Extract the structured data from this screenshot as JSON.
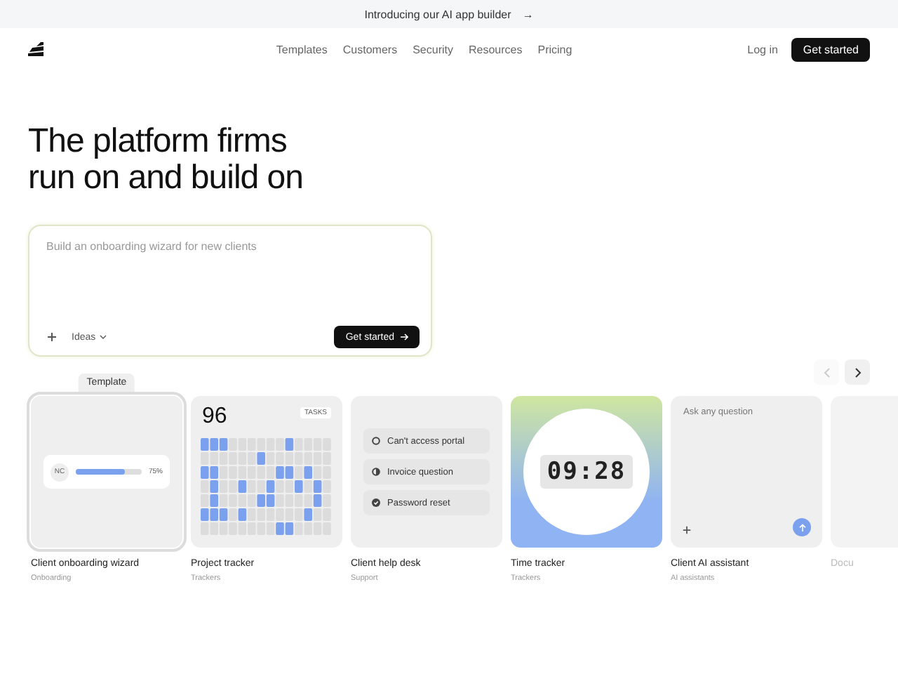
{
  "banner": {
    "text": "Introducing our AI app builder",
    "arrow": "→"
  },
  "nav": {
    "links": [
      "Templates",
      "Customers",
      "Security",
      "Resources",
      "Pricing"
    ],
    "login": "Log in",
    "cta": "Get started"
  },
  "hero": {
    "title_lines": [
      "The platform firms",
      "run on and build on"
    ]
  },
  "prompt": {
    "placeholder": "Build an onboarding wizard for new clients",
    "ideas": "Ideas",
    "submit": "Get started"
  },
  "carousel": {
    "prev_disabled": true,
    "next_disabled": false
  },
  "cards": [
    {
      "kind": "onboarding",
      "title": "Client onboarding wizard",
      "category": "Onboarding",
      "badge": "Template",
      "selected": true,
      "initials": "NC",
      "level": 0.75,
      "reading": "75%"
    },
    {
      "kind": "tracker",
      "title": "Project tracker",
      "category": "Trackers",
      "selected": false,
      "count": "96",
      "tag": "TASKS"
    },
    {
      "kind": "helpdesk",
      "title": "Client help desk",
      "category": "Support",
      "selected": false,
      "tickets": [
        {
          "label": "Can't access portal",
          "kind": "open"
        },
        {
          "label": "Invoice question",
          "kind": "pending"
        },
        {
          "label": "Password reset",
          "kind": "done"
        }
      ]
    },
    {
      "kind": "timer",
      "title": "Time tracker",
      "category": "Trackers",
      "selected": false,
      "time": "09:28"
    },
    {
      "kind": "assistant",
      "title": "Client AI assistant",
      "category": "AI assistants",
      "selected": false,
      "placeholder": "Ask any question"
    },
    {
      "kind": "faded",
      "title": "Docu",
      "selected": false
    }
  ]
}
